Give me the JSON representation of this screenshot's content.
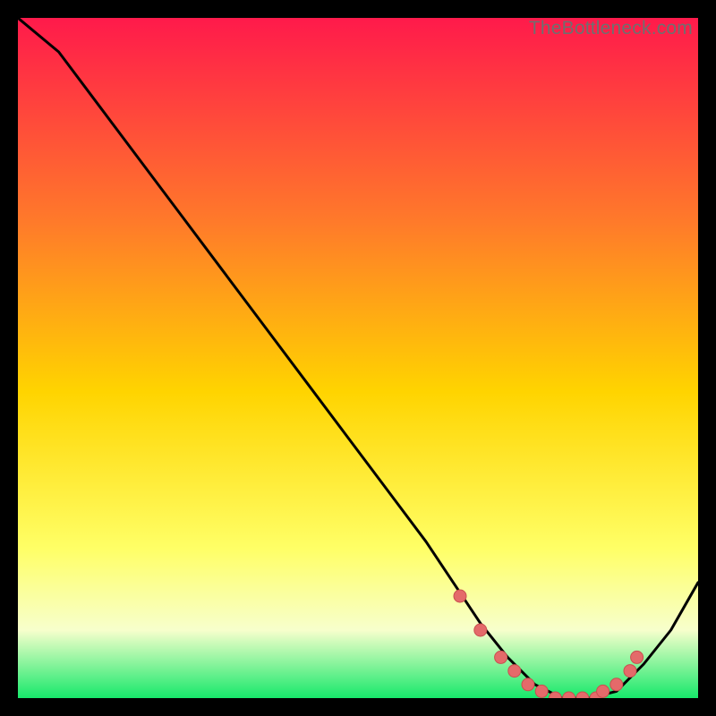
{
  "watermark": "TheBottleneck.com",
  "colors": {
    "gradient_top": "#ff1a4b",
    "gradient_mid1": "#ff7a2a",
    "gradient_mid2": "#ffd400",
    "gradient_mid3": "#ffff66",
    "gradient_bottom_band": "#f7ffcc",
    "gradient_green": "#17e86b",
    "curve": "#000000",
    "marker_fill": "#e46a6a",
    "marker_stroke": "#c94f4f"
  },
  "chart_data": {
    "type": "line",
    "title": "",
    "xlabel": "",
    "ylabel": "",
    "xlim": [
      0,
      100
    ],
    "ylim": [
      0,
      100
    ],
    "series": [
      {
        "name": "curve",
        "x": [
          0,
          6,
          12,
          18,
          24,
          30,
          36,
          42,
          48,
          54,
          60,
          64,
          68,
          72,
          76,
          80,
          84,
          88,
          92,
          96,
          100
        ],
        "y": [
          100,
          95,
          87,
          79,
          71,
          63,
          55,
          47,
          39,
          31,
          23,
          17,
          11,
          6,
          2,
          0,
          0,
          1,
          5,
          10,
          17
        ]
      }
    ],
    "markers": {
      "name": "highlight-points",
      "x": [
        65,
        68,
        71,
        73,
        75,
        77,
        79,
        81,
        83,
        85,
        86,
        88,
        90,
        91
      ],
      "y": [
        15,
        10,
        6,
        4,
        2,
        1,
        0,
        0,
        0,
        0,
        1,
        2,
        4,
        6
      ]
    }
  }
}
